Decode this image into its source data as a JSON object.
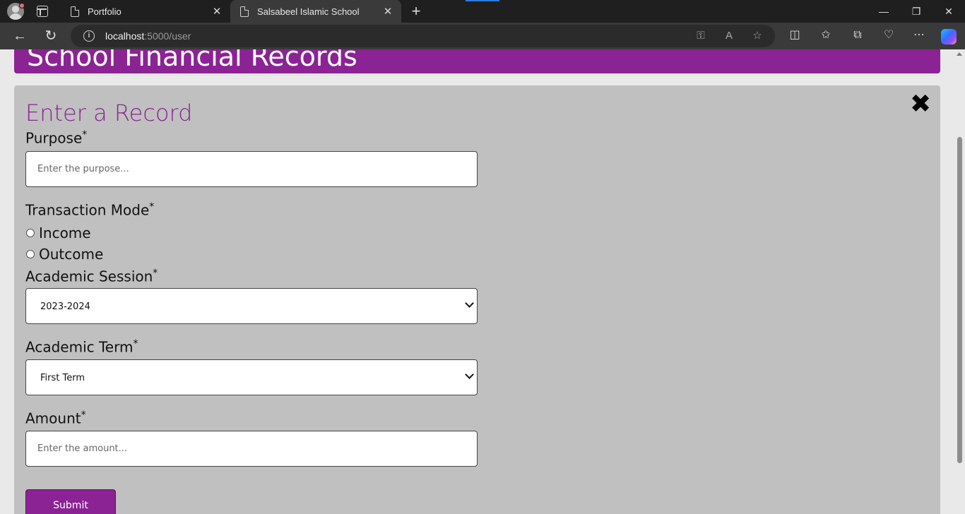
{
  "browser": {
    "tabs": [
      {
        "title": "Portfolio",
        "active": false
      },
      {
        "title": "Salsabeel Islamic School",
        "active": true
      }
    ],
    "url_host": "localhost",
    "url_path": ":5000/user",
    "icons": {
      "profile": "profile-avatar-icon",
      "tab_actions": "tab-actions-icon",
      "tab_page": "page-icon",
      "close": "close-icon",
      "new_tab": "plus-icon",
      "minimize": "minimize-icon",
      "restore": "restore-icon",
      "window_close": "window-close-icon",
      "back": "back-arrow-icon",
      "refresh": "refresh-icon",
      "site_info": "info-icon",
      "passwords": "key-icon",
      "read_aloud": "read-aloud-icon",
      "favorite": "star-icon",
      "split": "split-screen-icon",
      "favorites": "favorites-icon",
      "collections": "collections-icon",
      "browser_essentials": "heart-pulse-icon",
      "more": "more-dots-icon",
      "copilot": "copilot-icon"
    }
  },
  "page": {
    "header_title": "School Financial Records",
    "accent_color": "#8b2394",
    "form": {
      "title": "Enter a Record",
      "required_mark": "*",
      "purpose": {
        "label": "Purpose",
        "placeholder": "Enter the purpose..."
      },
      "transaction_mode": {
        "label": "Transaction Mode",
        "options": [
          "Income",
          "Outcome"
        ]
      },
      "academic_session": {
        "label": "Academic Session",
        "value": "2023-2024"
      },
      "academic_term": {
        "label": "Academic Term",
        "value": "First Term"
      },
      "amount": {
        "label": "Amount",
        "placeholder": "Enter the amount..."
      },
      "submit_label": "Submit"
    }
  }
}
